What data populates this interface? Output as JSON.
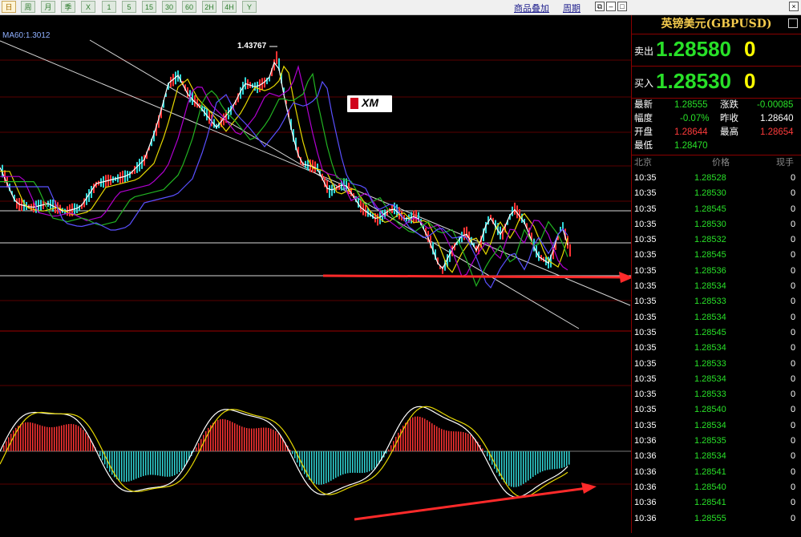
{
  "toolbar": {
    "buttons": [
      "日",
      "周",
      "月",
      "季",
      "X",
      "1",
      "5",
      "15",
      "30",
      "60",
      "2H",
      "4H",
      "Y"
    ],
    "links": [
      "商品叠加",
      "周期"
    ],
    "window_icons": [
      "copy-icon",
      "minimize-icon",
      "restore-icon",
      "close-icon"
    ]
  },
  "chart": {
    "ma_label": "MA60:1.3012",
    "peak_label": "1.43767",
    "logo_text": "XM",
    "colors": {
      "up": "#ff3333",
      "down": "#31d6d6",
      "ma1": "#ffffff",
      "ma2": "#e6d800",
      "ma3": "#b000d0",
      "ma4": "#22b422",
      "ma5": "#5a50ff",
      "arrow": "#ff2a2a",
      "grid": "#5a0000"
    }
  },
  "panel": {
    "title": "英镑美元(GBPUSD)",
    "sell_label": "卖出",
    "sell_value": "1.28580",
    "sell_volume": "0",
    "buy_label": "买入",
    "buy_value": "1.28530",
    "buy_volume": "0",
    "stats": [
      {
        "label": "最新",
        "value": "1.28555",
        "label2": "涨跌",
        "value2": "-0.00085"
      },
      {
        "label": "幅度",
        "value": "-0.07%",
        "label2": "昨收",
        "value2": "1.28640"
      },
      {
        "label": "开盘",
        "value": "1.28644",
        "label2": "最高",
        "value2": "1.28654"
      },
      {
        "label": "最低",
        "value": "1.28470",
        "label2": "",
        "value2": ""
      }
    ],
    "ticks_header": {
      "time": "北京",
      "price": "价格",
      "volume": "现手"
    },
    "ticks": [
      {
        "time": "10:35",
        "price": "1.28528",
        "volume": "0"
      },
      {
        "time": "10:35",
        "price": "1.28530",
        "volume": "0"
      },
      {
        "time": "10:35",
        "price": "1.28545",
        "volume": "0"
      },
      {
        "time": "10:35",
        "price": "1.28530",
        "volume": "0"
      },
      {
        "time": "10:35",
        "price": "1.28532",
        "volume": "0"
      },
      {
        "time": "10:35",
        "price": "1.28545",
        "volume": "0"
      },
      {
        "time": "10:35",
        "price": "1.28536",
        "volume": "0"
      },
      {
        "time": "10:35",
        "price": "1.28534",
        "volume": "0"
      },
      {
        "time": "10:35",
        "price": "1.28533",
        "volume": "0"
      },
      {
        "time": "10:35",
        "price": "1.28534",
        "volume": "0"
      },
      {
        "time": "10:35",
        "price": "1.28545",
        "volume": "0"
      },
      {
        "time": "10:35",
        "price": "1.28534",
        "volume": "0"
      },
      {
        "time": "10:35",
        "price": "1.28533",
        "volume": "0"
      },
      {
        "time": "10:35",
        "price": "1.28534",
        "volume": "0"
      },
      {
        "time": "10:35",
        "price": "1.28533",
        "volume": "0"
      },
      {
        "time": "10:35",
        "price": "1.28540",
        "volume": "0"
      },
      {
        "time": "10:35",
        "price": "1.28534",
        "volume": "0"
      },
      {
        "time": "10:36",
        "price": "1.28535",
        "volume": "0"
      },
      {
        "time": "10:36",
        "price": "1.28534",
        "volume": "0"
      },
      {
        "time": "10:36",
        "price": "1.28541",
        "volume": "0"
      },
      {
        "time": "10:36",
        "price": "1.28540",
        "volume": "0"
      },
      {
        "time": "10:36",
        "price": "1.28541",
        "volume": "0"
      },
      {
        "time": "10:36",
        "price": "1.28555",
        "volume": "0"
      }
    ]
  }
}
